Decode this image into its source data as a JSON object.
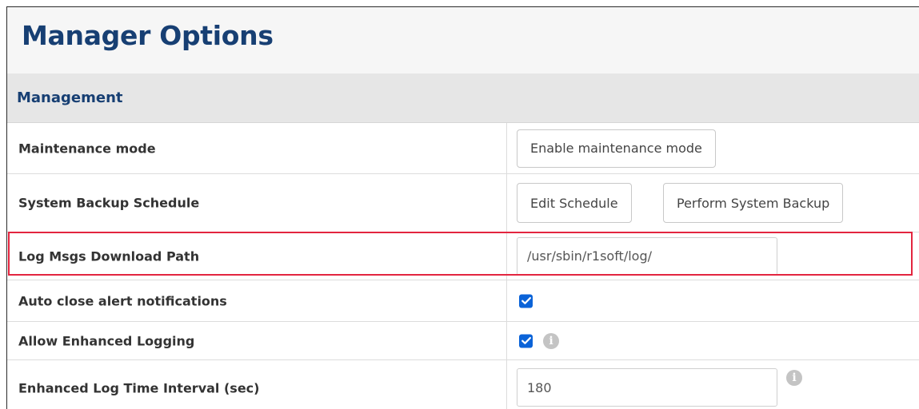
{
  "page": {
    "title": "Manager Options"
  },
  "section": {
    "title": "Management"
  },
  "rows": {
    "maintenance": {
      "label": "Maintenance mode",
      "button_label": "Enable maintenance mode"
    },
    "backup": {
      "label": "System Backup Schedule",
      "edit_label": "Edit Schedule",
      "perform_label": "Perform System Backup"
    },
    "log_path": {
      "label": "Log Msgs Download Path",
      "value": "/usr/sbin/r1soft/log/"
    },
    "auto_close": {
      "label": "Auto close alert notifications",
      "checked": true
    },
    "enhanced": {
      "label": "Allow Enhanced Logging",
      "checked": true,
      "info_icon": "info-icon"
    },
    "interval": {
      "label": "Enhanced Log Time Interval (sec)",
      "value": "180",
      "info_icon": "info-icon"
    }
  },
  "colors": {
    "title": "#173f73",
    "section_bg": "#e6e6e6",
    "checkbox": "#0b63d8",
    "highlight": "#e3253f"
  }
}
